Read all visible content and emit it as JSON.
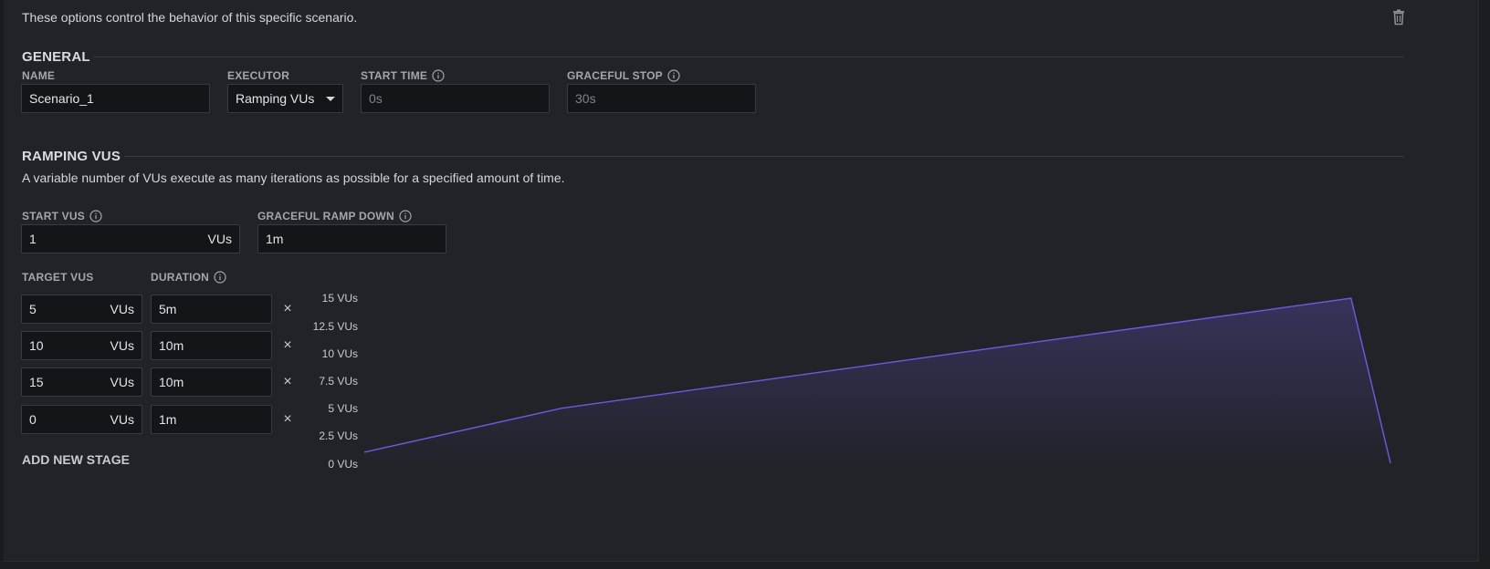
{
  "header": {
    "description": "These options control the behavior of this specific scenario."
  },
  "general": {
    "title": "GENERAL",
    "name_label": "NAME",
    "name_value": "Scenario_1",
    "executor_label": "EXECUTOR",
    "executor_value": "Ramping VUs",
    "start_time_label": "START TIME",
    "start_time_placeholder": "0s",
    "graceful_stop_label": "GRACEFUL STOP",
    "graceful_stop_placeholder": "30s"
  },
  "ramping": {
    "title": "RAMPING VUS",
    "description": "A variable number of VUs execute as many iterations as possible for a specified amount of time.",
    "start_vus_label": "START VUS",
    "start_vus_value": "1",
    "start_vus_unit": "VUs",
    "graceful_ramp_down_label": "GRACEFUL RAMP DOWN",
    "graceful_ramp_down_value": "1m",
    "target_vus_label": "TARGET VUS",
    "duration_label": "DURATION",
    "stages": [
      {
        "target": "5",
        "unit": "VUs",
        "duration": "5m",
        "remove": "×"
      },
      {
        "target": "10",
        "unit": "VUs",
        "duration": "10m",
        "remove": "×"
      },
      {
        "target": "15",
        "unit": "VUs",
        "duration": "10m",
        "remove": "×"
      },
      {
        "target": "0",
        "unit": "VUs",
        "duration": "1m",
        "remove": "×"
      }
    ],
    "add_stage_label": "ADD NEW STAGE"
  },
  "chart_data": {
    "type": "area",
    "x_label": "",
    "y_label": "",
    "ylim": [
      0,
      15
    ],
    "y_ticks": [
      "15 VUs",
      "12.5 VUs",
      "10 VUs",
      "7.5 VUs",
      "5 VUs",
      "2.5 VUs",
      "0 VUs"
    ],
    "x_minutes": [
      0,
      5,
      15,
      25,
      26
    ],
    "vus": [
      1,
      5,
      10,
      15,
      0
    ],
    "line_color": "#6e5be0",
    "fill_color": "#6e5be0"
  },
  "icons": {
    "trash": "trash-icon",
    "info": "info-icon",
    "caret": "caret-down-icon"
  }
}
